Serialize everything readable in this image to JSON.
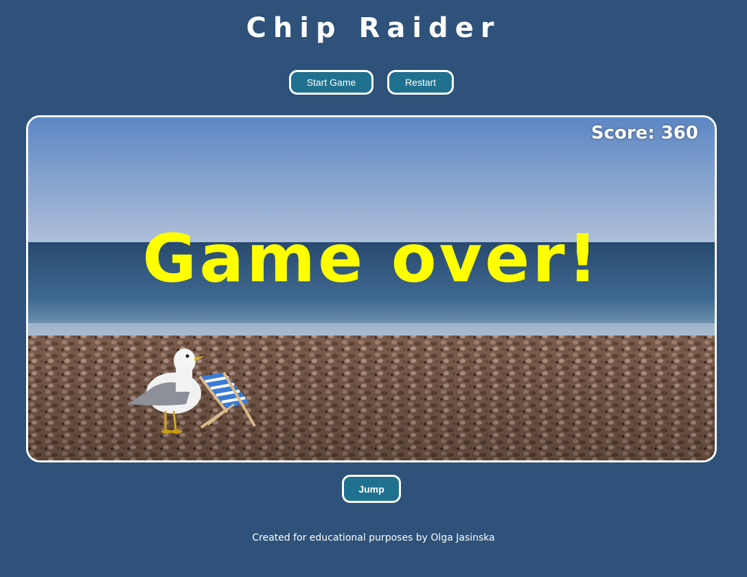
{
  "title": "Chip Raider",
  "controls": {
    "start_label": "Start Game",
    "restart_label": "Restart",
    "jump_label": "Jump"
  },
  "game": {
    "score_text": "Score: 360",
    "status_text": "Game over!",
    "status_color": "#ffff00"
  },
  "footer": "Created for educational purposes by Olga Jasinska",
  "colors": {
    "page_background": "#2e5279",
    "button_fill": "#20718f"
  }
}
